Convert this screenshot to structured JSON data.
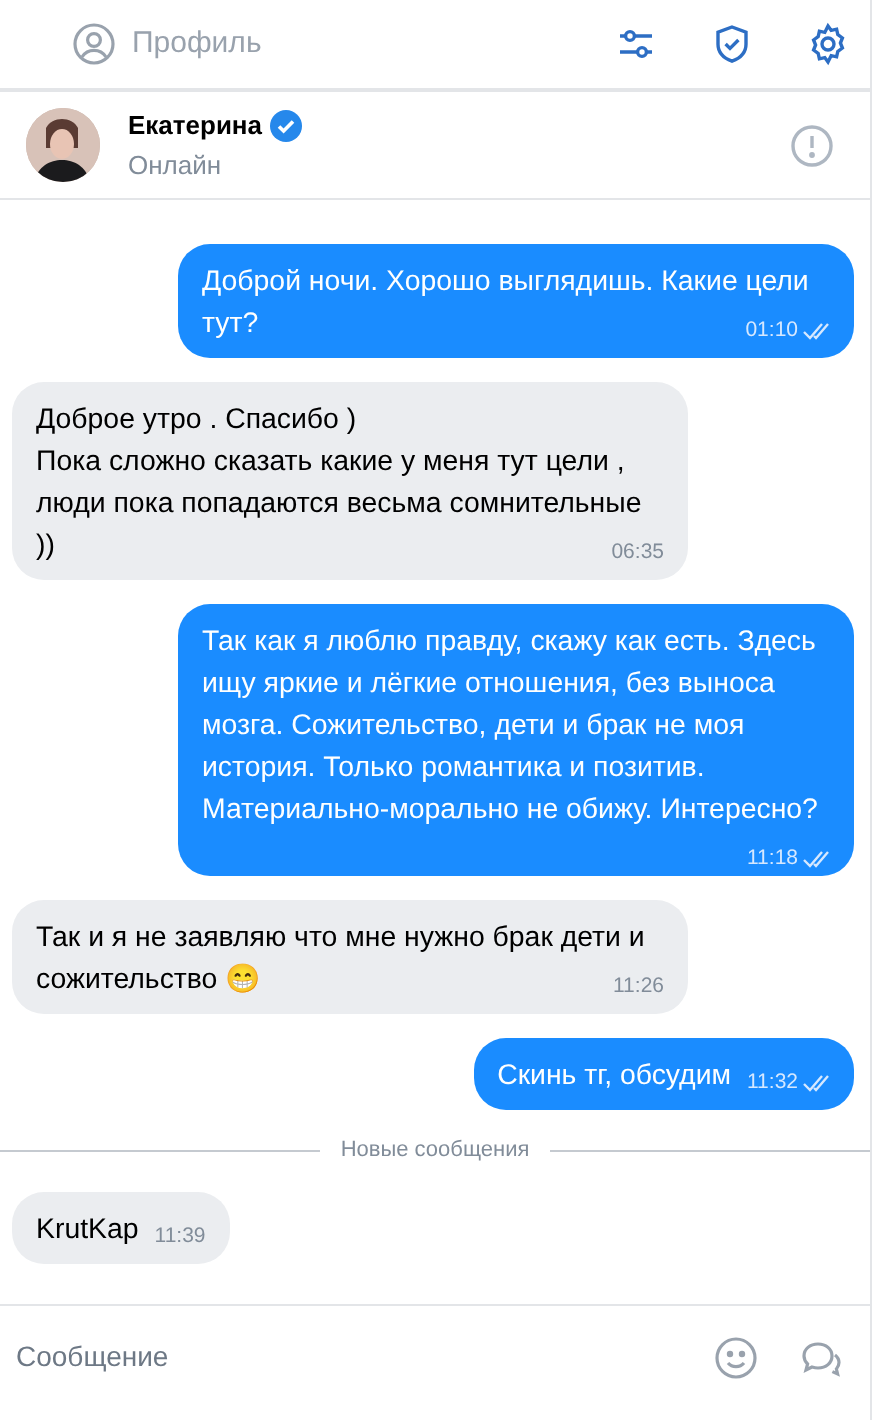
{
  "top_bar": {
    "profile_tab": {
      "label": "Профиль",
      "selected": false
    }
  },
  "contact": {
    "name": "Екатерина",
    "verified": true,
    "status": "Онлайн"
  },
  "messages": [
    {
      "kind": "message",
      "outgoing": true,
      "text": "Доброй ночи. Хорошо выглядишь. Какие цели тут?",
      "time": "01:10",
      "read": true
    },
    {
      "kind": "message",
      "outgoing": false,
      "text": "Доброе утро . Спасибо )\nПока сложно сказать какие у меня тут цели , люди пока попадаются весьма сомнительные ))",
      "time": "06:35",
      "read": false
    },
    {
      "kind": "message",
      "outgoing": true,
      "text": "Так как я люблю правду, скажу как есть. Здесь ищу яркие и лёгкие отношения, без выноса мозга. Сожительство, дети и брак не моя история. Только романтика и позитив. Материально-морально не обижу. Интересно?",
      "time": "11:18",
      "read": true
    },
    {
      "kind": "message",
      "outgoing": false,
      "text": "Так и я не заявляю что мне нужно брак дети и сожительство 😁",
      "time": "11:26",
      "read": false
    },
    {
      "kind": "message",
      "outgoing": true,
      "text": "Скинь тг, обсудим",
      "time": "11:32",
      "read": true
    },
    {
      "kind": "separator",
      "text": "Новые сообщения"
    },
    {
      "kind": "message",
      "outgoing": false,
      "text": "KrutKap",
      "time": "11:39",
      "read": false
    }
  ],
  "composer": {
    "placeholder": "Сообщение"
  }
}
